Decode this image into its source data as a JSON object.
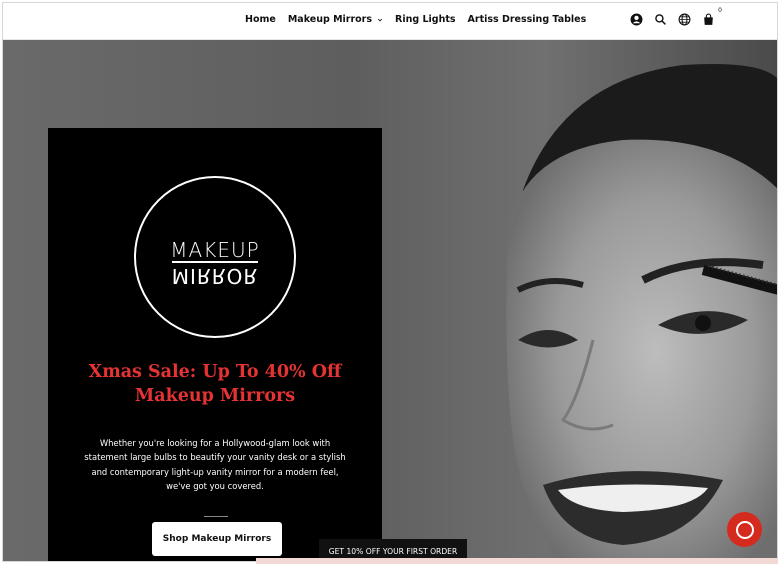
{
  "header": {
    "nav": [
      {
        "label": "Home",
        "has_dropdown": false
      },
      {
        "label": "Makeup Mirrors",
        "has_dropdown": true
      },
      {
        "label": "Ring Lights",
        "has_dropdown": false
      },
      {
        "label": "Artiss Dressing Tables",
        "has_dropdown": false
      }
    ],
    "icons": [
      "account-icon",
      "search-icon",
      "globe-icon",
      "cart-icon"
    ],
    "cart_count": "0"
  },
  "hero": {
    "logo_top": "MAKEUP",
    "logo_bottom": "MIRROR",
    "sale_title": "Xmas Sale: Up To 40% Off Makeup Mirrors",
    "description": "Whether you're looking for a Hollywood-glam look with statement large bulbs to beautify your vanity desk or a stylish and contemporary light-up vanity mirror for a modern feel, we've got you covered.",
    "cta_label": "Shop Makeup Mirrors"
  },
  "promo_bar": {
    "label": "GET 10% OFF YOUR FIRST ORDER"
  },
  "colors": {
    "accent_red": "#e53333",
    "chat_red": "#d42b1e",
    "panel_bg": "#000000"
  }
}
